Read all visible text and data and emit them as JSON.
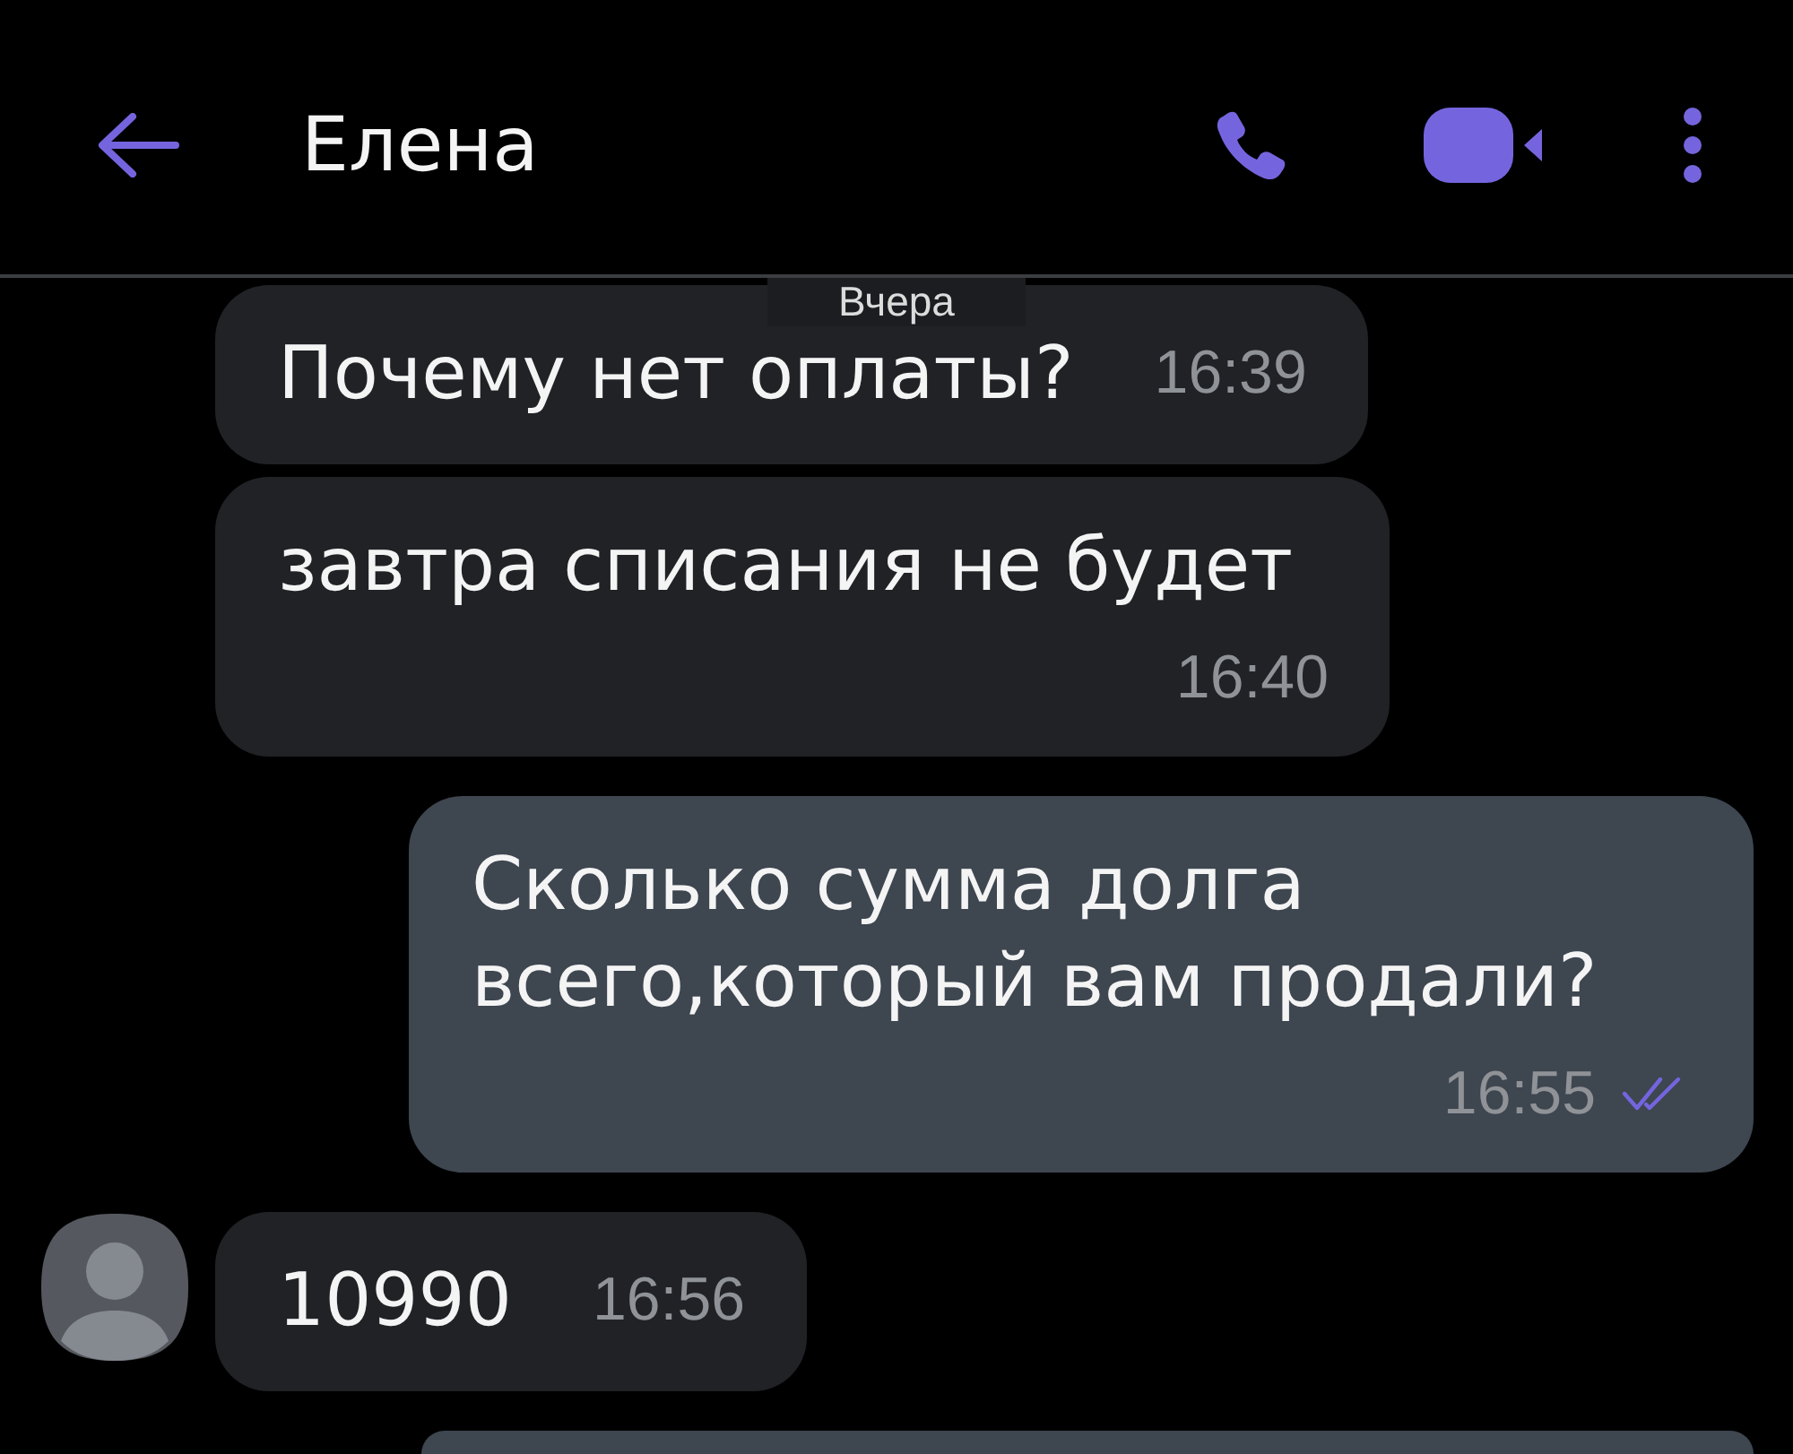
{
  "header": {
    "title": "Елена"
  },
  "date_label": "Вчера",
  "messages": [
    {
      "kind": "incoming",
      "avatar": false,
      "text": "Почему нет оплаты?",
      "time": "16:39"
    },
    {
      "kind": "incoming",
      "avatar": false,
      "text": "завтра списания не будет",
      "time": "16:40"
    },
    {
      "kind": "outgoing",
      "text": "Сколько сумма долга всего,который вам продали?",
      "time": "16:55",
      "read": true
    },
    {
      "kind": "incoming",
      "avatar": true,
      "text": "10990",
      "time": "16:56"
    },
    {
      "kind": "outgoing"
    }
  ]
}
